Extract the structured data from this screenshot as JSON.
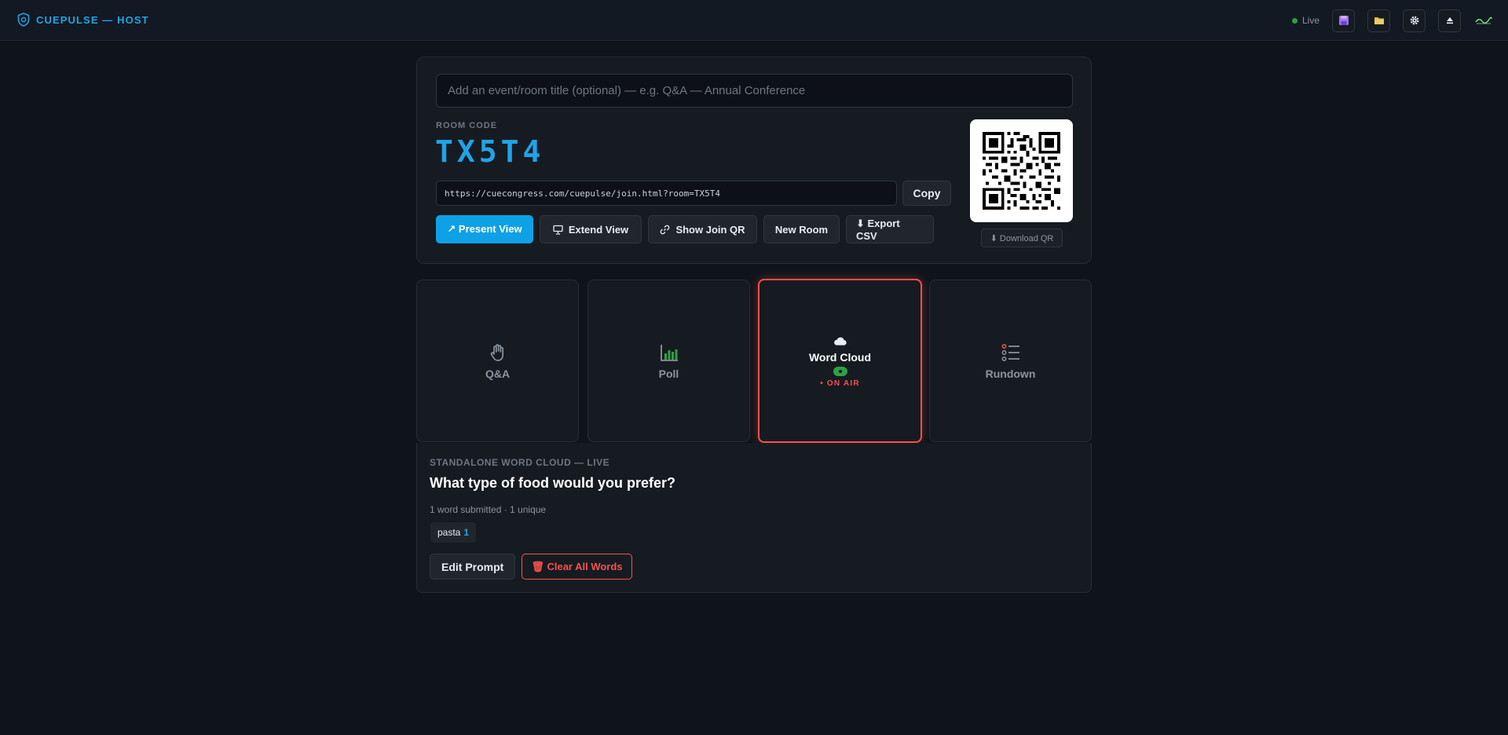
{
  "header": {
    "brand": "CUEPULSE — HOST",
    "status": "Live",
    "colors": {
      "accent": "#1fa4e8",
      "live": "#2ea043",
      "on_air": "#f85149"
    },
    "buttons": [
      {
        "name": "save-icon",
        "color": "#a371f7"
      },
      {
        "name": "folder-icon",
        "color": "#e3b341"
      },
      {
        "name": "gear-icon",
        "color": "#e6edf3"
      },
      {
        "name": "eject-icon",
        "color": "#e6edf3"
      }
    ]
  },
  "room": {
    "title_placeholder": "Add an event/room title (optional) — e.g. Q&A — Annual Conference",
    "code_label": "ROOM CODE",
    "code": "TX5T4",
    "join_url": "https://cuecongress.com/cuepulse/join.html?room=TX5T4",
    "copy_label": "Copy",
    "actions": {
      "present": "↗ Present View",
      "extend": "Extend View",
      "show_qr": "Show Join QR",
      "new_room": "New Room",
      "export": "⬇ Export CSV"
    },
    "download_qr": "⬇ Download QR"
  },
  "modes": {
    "qa": "Q&A",
    "poll": "Poll",
    "word_cloud": "Word Cloud",
    "rundown": "Rundown",
    "on_air": "• ON AIR"
  },
  "word_cloud": {
    "header": "STANDALONE WORD CLOUD — LIVE",
    "prompt": "What type of food would you prefer?",
    "stats": "1 word submitted · 1 unique",
    "words": [
      {
        "word": "pasta",
        "count": "1"
      }
    ],
    "edit_label": "Edit Prompt",
    "clear_label": "🗑 Clear All Words"
  }
}
